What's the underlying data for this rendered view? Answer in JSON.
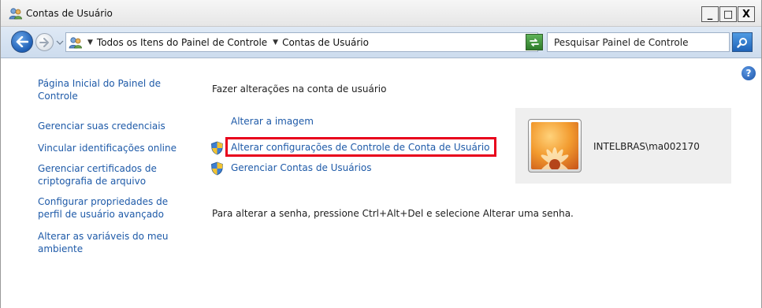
{
  "window": {
    "title": "Contas de Usuário"
  },
  "title_buttons": {
    "minimize": "_",
    "maximize": "□",
    "close": "X"
  },
  "address_bar": {
    "breadcrumb": [
      "Todos os Itens do Painel de Controle",
      "Contas de Usuário"
    ],
    "search_placeholder": "Pesquisar Painel de Controle"
  },
  "sidebar": {
    "items": [
      {
        "label": "Página Inicial do Painel de Controle"
      },
      {
        "label": "Gerenciar suas credenciais"
      },
      {
        "label": "Vincular identificações online"
      },
      {
        "label": "Gerenciar certificados de criptografia de arquivo"
      },
      {
        "label": "Configurar propriedades de perfil de usuário avançado"
      },
      {
        "label": "Alterar as variáveis do meu ambiente"
      }
    ]
  },
  "main": {
    "heading": "Fazer alterações na conta de usuário",
    "tasks": [
      {
        "label": "Alterar a imagem",
        "icon": "none"
      },
      {
        "label": "Alterar configurações de Controle de Conta de Usuário",
        "icon": "uac-shield-icon",
        "highlighted": true
      },
      {
        "label": "Gerenciar Contas de Usuários",
        "icon": "uac-shield-icon"
      }
    ],
    "password_note": "Para alterar a senha, pressione Ctrl+Alt+Del e selecione Alterar uma senha."
  },
  "user": {
    "name": "INTELBRAS\\ma002170"
  },
  "colors": {
    "link": "#1e5aa8",
    "highlight_border": "#e8001b",
    "tile_bg": "#efefef"
  },
  "help": {
    "glyph": "?"
  }
}
